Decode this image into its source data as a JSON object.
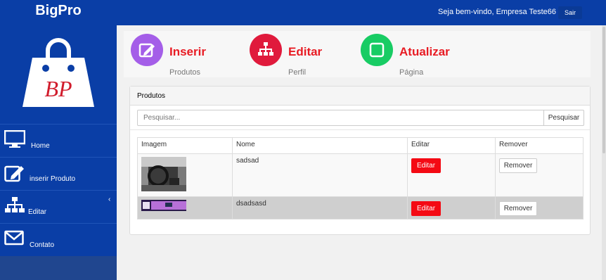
{
  "brand": "BigPro",
  "logo_text": "BP",
  "header": {
    "welcome": "Seja bem-vindo, Empresa Teste66",
    "logout": "Sair"
  },
  "nav": [
    {
      "label": "Home",
      "icon": "monitor-icon"
    },
    {
      "label": "inserir Produto",
      "icon": "edit-icon"
    },
    {
      "label": "Editar",
      "icon": "sitemap-icon"
    },
    {
      "label": "Contato",
      "icon": "envelope-icon"
    }
  ],
  "collapse_glyph": "‹",
  "actions": [
    {
      "title": "Inserir",
      "sub": "Produtos",
      "color": "#a45ee8",
      "icon": "edit-icon"
    },
    {
      "title": "Editar",
      "sub": "Perfil",
      "color": "#e01a3c",
      "icon": "sitemap-icon"
    },
    {
      "title": "Atualizar",
      "sub": "Página",
      "color": "#18cc64",
      "icon": "refresh-icon"
    }
  ],
  "panel": {
    "title": "Produtos",
    "search_placeholder": "Pesquisar...",
    "search_button": "Pesquisar",
    "columns": [
      "Imagem",
      "Nome",
      "Editar",
      "Remover"
    ],
    "rows": [
      {
        "name": "sadsad",
        "edit": "Editar",
        "remove": "Remover"
      },
      {
        "name": "dsadsasd",
        "edit": "Editar",
        "remove": "Remover"
      }
    ]
  },
  "colors": {
    "primary": "#0a3ea6",
    "danger": "#f40a14"
  }
}
